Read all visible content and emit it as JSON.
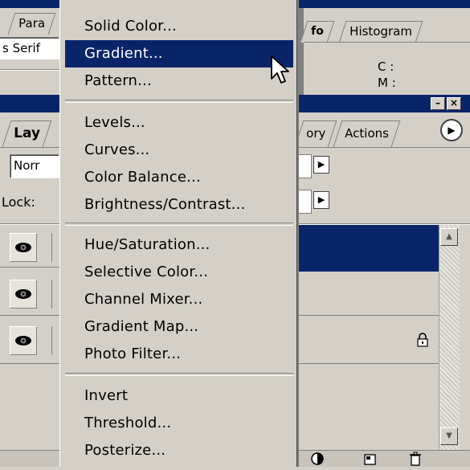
{
  "background": {
    "left_panel": {
      "tab_label": "Para",
      "font_field": "s Serif",
      "layers_tab": "Lay",
      "blend_field": "Norr",
      "lock_label": "Lock:"
    },
    "right_panel": {
      "info_tab": "fo",
      "histogram_tab": "Histogram",
      "info_c": "C :",
      "info_m": "M :",
      "history_tab": "ory",
      "actions_tab": "Actions",
      "minimize": "–",
      "close": "×",
      "menu_arrow": "▶"
    }
  },
  "menu": {
    "groups": [
      [
        "Solid Color...",
        "Gradient...",
        "Pattern..."
      ],
      [
        "Levels...",
        "Curves...",
        "Color Balance...",
        "Brightness/Contrast..."
      ],
      [
        "Hue/Saturation...",
        "Selective Color...",
        "Channel Mixer...",
        "Gradient Map...",
        "Photo Filter..."
      ],
      [
        "Invert",
        "Threshold...",
        "Posterize..."
      ]
    ],
    "highlighted": "Gradient..."
  },
  "colors": {
    "highlight": "#0a246a",
    "panel": "#d4d0c8"
  }
}
